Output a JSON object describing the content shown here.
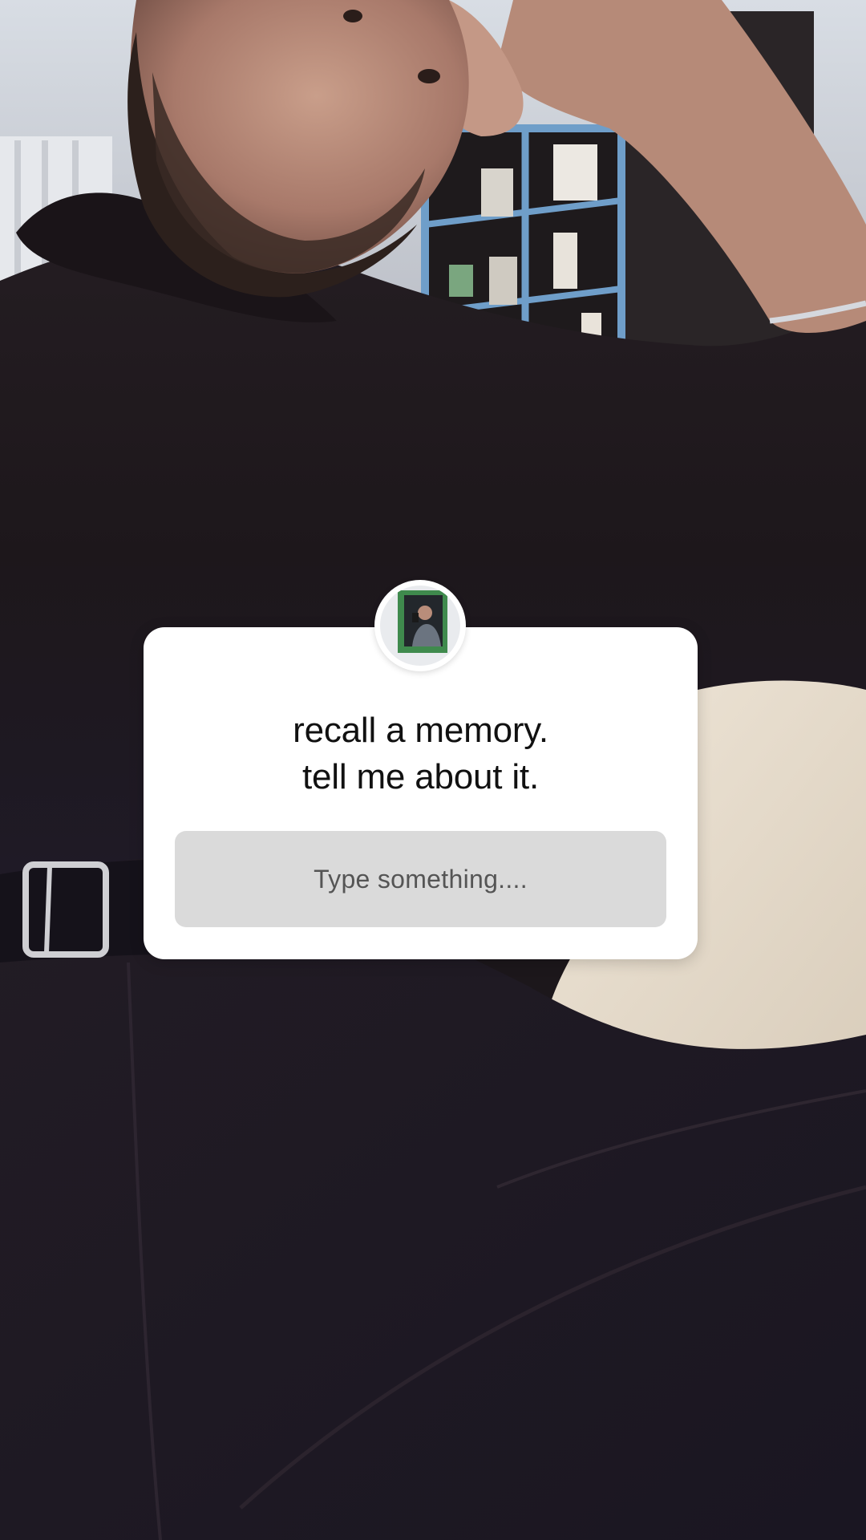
{
  "story": {
    "sticker": {
      "question_line_1": "recall a memory.",
      "question_line_2": "tell me about it.",
      "input_placeholder": "Type something...."
    }
  },
  "colors": {
    "sticker_bg": "#ffffff",
    "input_bg": "#dadada",
    "question_text": "#111111",
    "placeholder_text": "#555555"
  },
  "icons": {
    "avatar": "profile-photo"
  }
}
